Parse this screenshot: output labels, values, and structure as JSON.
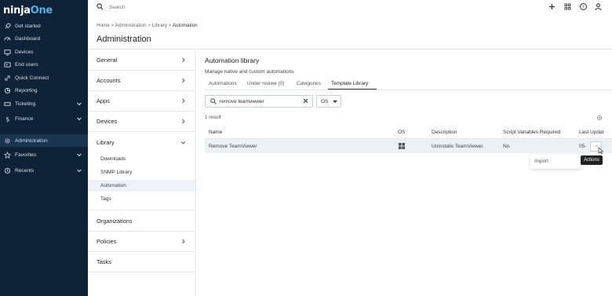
{
  "brand": {
    "logo_main": "ninja",
    "logo_accent": "One"
  },
  "sidebar": {
    "items": [
      {
        "label": "Get started",
        "icon": "rocket-icon"
      },
      {
        "label": "Dashboard",
        "icon": "gauge-icon"
      },
      {
        "label": "Devices",
        "icon": "monitor-icon"
      },
      {
        "label": "End users",
        "icon": "users-icon"
      },
      {
        "label": "Quick Connect",
        "icon": "link-icon"
      },
      {
        "label": "Reporting",
        "icon": "chart-icon"
      },
      {
        "label": "Ticketing",
        "icon": "ticket-icon"
      },
      {
        "label": "Finance",
        "icon": "dollar-icon"
      },
      {
        "label": "Administration",
        "icon": "gear-icon"
      },
      {
        "label": "Favorites",
        "icon": "star-icon"
      },
      {
        "label": "Recents",
        "icon": "history-icon"
      }
    ]
  },
  "topbar": {
    "search_placeholder": "Search"
  },
  "breadcrumb": {
    "home": "Home",
    "sep": ">",
    "admin": "Administration",
    "library": "Library",
    "current": "Automation"
  },
  "page": {
    "title": "Administration"
  },
  "admin_menu": {
    "general": "General",
    "accounts": "Accounts",
    "apps": "Apps",
    "devices": "Devices",
    "library": "Library",
    "library_sub": [
      "Downloads",
      "SNMP Library",
      "Automation",
      "Tags"
    ],
    "organizations": "Organizations",
    "policies": "Policies",
    "tasks": "Tasks"
  },
  "library": {
    "title": "Automation library",
    "subtitle": "Manage native and custom automations",
    "tabs": [
      "Automations",
      "Under review (0)",
      "Categories",
      "Template Library"
    ],
    "active_tab": "Template Library",
    "filter_value": "remove teamviewer",
    "os_filter": "OS",
    "result_count": "1 result",
    "columns": [
      "Name",
      "OS",
      "Description",
      "Script Variables Required",
      "Last Updat"
    ],
    "rows": [
      {
        "name": "Remove TeamViewer",
        "os_icon": "windows-icon",
        "description": "Uninstalls TeamViewer.",
        "vars_required": "No",
        "last_updated": "05-"
      }
    ],
    "actions_button": "···",
    "dropdown_item": "Import",
    "tooltip": "Actions"
  },
  "colors": {
    "sidebar_bg": "#0f2338",
    "accent": "#4fb3e8",
    "row_bg": "#eef0f3"
  }
}
